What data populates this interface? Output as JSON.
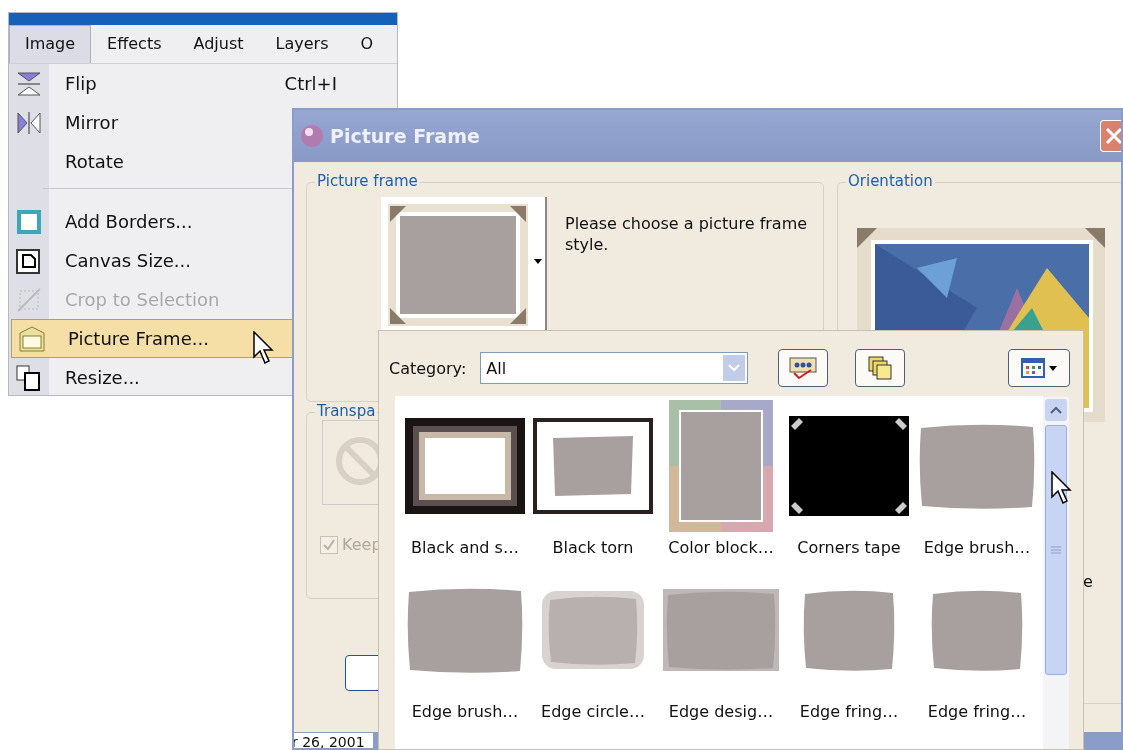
{
  "app_menu": {
    "menubar": [
      {
        "label": "Image",
        "selected": true
      },
      {
        "label": "Effects",
        "selected": false
      },
      {
        "label": "Adjust",
        "selected": false
      },
      {
        "label": "Layers",
        "selected": false
      },
      {
        "label": "O",
        "selected": false
      }
    ],
    "items": [
      {
        "kind": "flip",
        "label": "Flip",
        "shortcut": "Ctrl+I",
        "disabled": false,
        "selected": false
      },
      {
        "kind": "mirror",
        "label": "Mirror",
        "disabled": false,
        "selected": false
      },
      {
        "kind": "plain",
        "label": "Rotate",
        "disabled": false,
        "selected": false
      },
      {
        "kind": "separator"
      },
      {
        "kind": "borders",
        "label": "Add Borders...",
        "disabled": false,
        "selected": false
      },
      {
        "kind": "canvas",
        "label": "Canvas Size...",
        "disabled": false,
        "selected": false
      },
      {
        "kind": "crop",
        "label": "Crop to Selection",
        "disabled": true,
        "selected": false
      },
      {
        "kind": "frame",
        "label": "Picture Frame...",
        "disabled": false,
        "selected": true
      },
      {
        "kind": "resize",
        "label": "Resize...",
        "disabled": false,
        "selected": false
      }
    ]
  },
  "dialog": {
    "title": "Picture Frame",
    "frame_group": {
      "label": "Picture frame",
      "hint": "Please choose a picture frame style."
    },
    "orientation_group": {
      "label": "Orientation",
      "fragment": "e"
    },
    "transparency_group": {
      "label": "Transpa",
      "checkbox": {
        "label": "Keep",
        "checked": true,
        "disabled": true
      }
    }
  },
  "frame_picker": {
    "category_label": "Category:",
    "category_value": "All",
    "frames": [
      {
        "kind": "mat",
        "label": "Black and s…"
      },
      {
        "kind": "torn",
        "label": "Black torn"
      },
      {
        "kind": "blocks",
        "label": "Color block…"
      },
      {
        "kind": "tape",
        "label": "Corners tape"
      },
      {
        "kind": "brush",
        "label": "Edge brush…"
      },
      {
        "kind": "brush",
        "label": "Edge brush…"
      },
      {
        "kind": "soft",
        "label": "Edge circle…"
      },
      {
        "kind": "ragged",
        "label": "Edge desig…"
      },
      {
        "kind": "fringe",
        "label": "Edge fring…"
      },
      {
        "kind": "fringe",
        "label": "Edge fring…"
      }
    ]
  },
  "status_bar": {
    "date": "r 26, 2001"
  }
}
